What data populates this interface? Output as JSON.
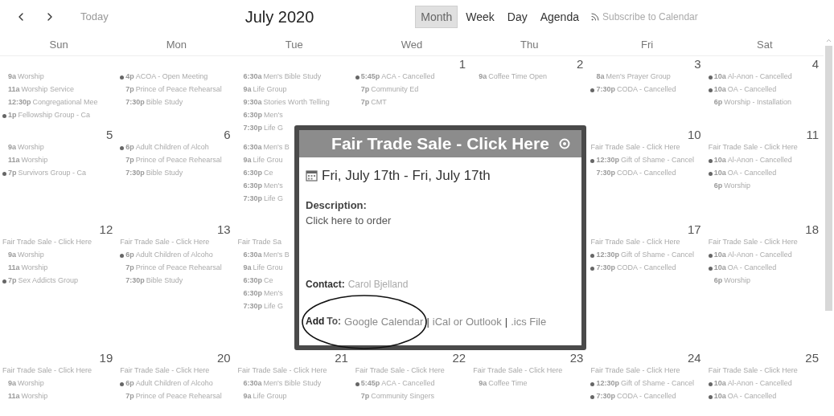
{
  "toolbar": {
    "today": "Today",
    "title": "July 2020",
    "views": [
      {
        "label": "Month",
        "selected": true
      },
      {
        "label": "Week",
        "selected": false
      },
      {
        "label": "Day",
        "selected": false
      },
      {
        "label": "Agenda",
        "selected": false
      }
    ],
    "subscribe": "Subscribe to Calendar"
  },
  "weekdays": [
    "Sun",
    "Mon",
    "Tue",
    "Wed",
    "Thu",
    "Fri",
    "Sat"
  ],
  "weeks": [
    {
      "days": [
        {
          "kind": "day",
          "events": [
            {
              "kind": "timed",
              "bullet": false,
              "time": "9a",
              "title": "Worship"
            },
            {
              "kind": "timed",
              "bullet": false,
              "time": "11a",
              "title": "Worship Service"
            },
            {
              "kind": "timed",
              "bullet": false,
              "time": "12:30p",
              "title": "Congregational Mee"
            },
            {
              "kind": "timed",
              "bullet": true,
              "time": "1p",
              "title": "Fellowship Group - Ca"
            }
          ]
        },
        {
          "kind": "day",
          "events": [
            {
              "kind": "timed",
              "bullet": true,
              "time": "4p",
              "title": "ACOA - Open Meeting"
            },
            {
              "kind": "timed",
              "bullet": false,
              "time": "7p",
              "title": "Prince of Peace Rehearsal"
            },
            {
              "kind": "timed",
              "bullet": false,
              "time": "7:30p",
              "title": "Bible Study"
            }
          ]
        },
        {
          "kind": "day",
          "events": [
            {
              "kind": "timed",
              "bullet": false,
              "time": "6:30a",
              "title": "Men's Bible Study"
            },
            {
              "kind": "timed",
              "bullet": false,
              "time": "9a",
              "title": "Life Group"
            },
            {
              "kind": "timed",
              "bullet": false,
              "time": "9:30a",
              "title": "Stories Worth Telling"
            },
            {
              "kind": "timed",
              "bullet": false,
              "time": "6:30p",
              "title": "Men's"
            },
            {
              "kind": "timed",
              "bullet": false,
              "time": "7:30p",
              "title": "Life G"
            }
          ]
        },
        {
          "kind": "day",
          "number": "1",
          "events": [
            {
              "kind": "timed",
              "bullet": true,
              "time": "5:45p",
              "title": "ACA - Cancelled"
            },
            {
              "kind": "timed",
              "bullet": false,
              "time": "7p",
              "title": "Community Ed"
            },
            {
              "kind": "timed",
              "bullet": false,
              "time": "7p",
              "title": "CMT"
            }
          ]
        },
        {
          "kind": "day",
          "number": "2",
          "events": [
            {
              "kind": "timed",
              "bullet": false,
              "time": "9a",
              "title": "Coffee Time Open"
            }
          ]
        },
        {
          "kind": "day",
          "number": "3",
          "events": [
            {
              "kind": "timed",
              "bullet": false,
              "time": "8a",
              "title": "Men's Prayer Group"
            },
            {
              "kind": "timed",
              "bullet": true,
              "time": "7:30p",
              "title": "CODA - Cancelled"
            }
          ]
        },
        {
          "kind": "day",
          "number": "4",
          "events": [
            {
              "kind": "timed",
              "bullet": true,
              "time": "10a",
              "title": "Al-Anon - Cancelled"
            },
            {
              "kind": "timed",
              "bullet": true,
              "time": "10a",
              "title": "OA - Cancelled"
            },
            {
              "kind": "timed",
              "bullet": false,
              "time": "6p",
              "title": "Worship - Installation"
            }
          ]
        }
      ]
    },
    {
      "days": [
        {
          "kind": "day",
          "number": "5",
          "events": [
            {
              "kind": "timed",
              "bullet": false,
              "time": "9a",
              "title": "Worship"
            },
            {
              "kind": "timed",
              "bullet": false,
              "time": "11a",
              "title": "Worship"
            },
            {
              "kind": "timed",
              "bullet": true,
              "time": "7p",
              "title": "Survivors Group - Ca"
            }
          ]
        },
        {
          "kind": "day",
          "number": "6",
          "events": [
            {
              "kind": "timed",
              "bullet": true,
              "time": "6p",
              "title": "Adult Children of Alcoh"
            },
            {
              "kind": "timed",
              "bullet": false,
              "time": "7p",
              "title": "Prince of Peace Rehearsal"
            },
            {
              "kind": "timed",
              "bullet": false,
              "time": "7:30p",
              "title": "Bible Study"
            }
          ]
        },
        {
          "kind": "day",
          "events": [
            {
              "kind": "timed",
              "bullet": false,
              "time": "6:30a",
              "title": "Men's B"
            },
            {
              "kind": "timed",
              "bullet": false,
              "time": "9a",
              "title": "Life Grou"
            },
            {
              "kind": "timed",
              "bullet": false,
              "time": "6:30p",
              "title": "Ce"
            },
            {
              "kind": "timed",
              "bullet": false,
              "time": "6:30p",
              "title": "Men's"
            },
            {
              "kind": "timed",
              "bullet": false,
              "time": "7:30p",
              "title": "Life G"
            }
          ]
        },
        {
          "kind": "covered"
        },
        {
          "kind": "covered"
        },
        {
          "kind": "day",
          "number": "10",
          "events": [
            {
              "kind": "allday",
              "title": "Fair Trade Sale - Click Here"
            },
            {
              "kind": "timed",
              "bullet": true,
              "time": "12:30p",
              "title": "Gift of Shame - Cancel"
            },
            {
              "kind": "timed",
              "bullet": false,
              "time": "7:30p",
              "title": "CODA - Cancelled"
            }
          ]
        },
        {
          "kind": "day",
          "number": "11",
          "events": [
            {
              "kind": "allday",
              "title": "Fair Trade Sale - Click Here"
            },
            {
              "kind": "timed",
              "bullet": true,
              "time": "10a",
              "title": "Al-Anon - Cancelled"
            },
            {
              "kind": "timed",
              "bullet": true,
              "time": "10a",
              "title": "OA - Cancelled"
            },
            {
              "kind": "timed",
              "bullet": false,
              "time": "6p",
              "title": "Worship"
            }
          ]
        }
      ]
    },
    {
      "days": [
        {
          "kind": "day",
          "number": "12",
          "events": [
            {
              "kind": "allday",
              "title": "Fair Trade Sale - Click Here"
            },
            {
              "kind": "timed",
              "bullet": false,
              "time": "9a",
              "title": "Worship"
            },
            {
              "kind": "timed",
              "bullet": false,
              "time": "11a",
              "title": "Worship"
            },
            {
              "kind": "timed",
              "bullet": true,
              "time": "7p",
              "title": "Sex Addicts Group"
            }
          ]
        },
        {
          "kind": "day",
          "number": "13",
          "events": [
            {
              "kind": "allday",
              "title": "Fair Trade Sale - Click Here"
            },
            {
              "kind": "timed",
              "bullet": true,
              "time": "6p",
              "title": "Adult Children of Alcoho"
            },
            {
              "kind": "timed",
              "bullet": false,
              "time": "7p",
              "title": "Prince of Peace Rehearsal"
            },
            {
              "kind": "timed",
              "bullet": false,
              "time": "7:30p",
              "title": "Bible Study"
            }
          ]
        },
        {
          "kind": "day",
          "events": [
            {
              "kind": "allday",
              "title": "Fair Trade Sa"
            },
            {
              "kind": "timed",
              "bullet": false,
              "time": "6:30a",
              "title": "Men's B"
            },
            {
              "kind": "timed",
              "bullet": false,
              "time": "9a",
              "title": "Life Grou"
            },
            {
              "kind": "timed",
              "bullet": false,
              "time": "6:30p",
              "title": "Ce"
            },
            {
              "kind": "timed",
              "bullet": false,
              "time": "6:30p",
              "title": "Men's"
            },
            {
              "kind": "timed",
              "bullet": false,
              "time": "7:30p",
              "title": "Life G"
            }
          ]
        },
        {
          "kind": "covered"
        },
        {
          "kind": "covered"
        },
        {
          "kind": "day",
          "number": "17",
          "events": [
            {
              "kind": "allday",
              "title": "Fair Trade Sale - Click Here"
            },
            {
              "kind": "timed",
              "bullet": true,
              "time": "12:30p",
              "title": "Gift of Shame - Cancel"
            },
            {
              "kind": "timed",
              "bullet": true,
              "time": "7:30p",
              "title": "CODA - Cancelled"
            }
          ]
        },
        {
          "kind": "day",
          "number": "18",
          "events": [
            {
              "kind": "allday",
              "title": "Fair Trade Sale - Click Here"
            },
            {
              "kind": "timed",
              "bullet": true,
              "time": "10a",
              "title": "Al-Anon - Cancelled"
            },
            {
              "kind": "timed",
              "bullet": true,
              "time": "10a",
              "title": "OA - Cancelled"
            },
            {
              "kind": "timed",
              "bullet": false,
              "time": "6p",
              "title": "Worship"
            }
          ]
        }
      ]
    },
    {
      "days": [
        {
          "kind": "day",
          "number": "19",
          "events": [
            {
              "kind": "allday",
              "title": "Fair Trade Sale - Click Here"
            },
            {
              "kind": "timed",
              "bullet": false,
              "time": "9a",
              "title": "Worship"
            },
            {
              "kind": "timed",
              "bullet": false,
              "time": "11a",
              "title": "Worship"
            }
          ]
        },
        {
          "kind": "day",
          "number": "20",
          "events": [
            {
              "kind": "allday",
              "title": "Fair Trade Sale - Click Here"
            },
            {
              "kind": "timed",
              "bullet": true,
              "time": "6p",
              "title": "Adult Children of Alcoho"
            },
            {
              "kind": "timed",
              "bullet": false,
              "time": "7p",
              "title": "Prince of Peace Rehearsal"
            }
          ]
        },
        {
          "kind": "day",
          "number": "21",
          "events": [
            {
              "kind": "allday",
              "title": "Fair Trade Sale - Click Here"
            },
            {
              "kind": "timed",
              "bullet": false,
              "time": "6:30a",
              "title": "Men's Bible Study"
            },
            {
              "kind": "timed",
              "bullet": false,
              "time": "9a",
              "title": "Life Group"
            }
          ]
        },
        {
          "kind": "day",
          "number": "22",
          "events": [
            {
              "kind": "allday",
              "title": "Fair Trade Sale - Click Here"
            },
            {
              "kind": "timed",
              "bullet": true,
              "time": "5:45p",
              "title": "ACA - Cancelled"
            },
            {
              "kind": "timed",
              "bullet": false,
              "time": "7p",
              "title": "Community Singers"
            }
          ]
        },
        {
          "kind": "day",
          "number": "23",
          "events": [
            {
              "kind": "allday",
              "title": "Fair Trade Sale - Click Here"
            },
            {
              "kind": "timed",
              "bullet": false,
              "time": "9a",
              "title": "Coffee Time"
            }
          ]
        },
        {
          "kind": "day",
          "number": "24",
          "events": [
            {
              "kind": "allday",
              "title": "Fair Trade Sale - Click Here"
            },
            {
              "kind": "timed",
              "bullet": true,
              "time": "12:30p",
              "title": "Gift of Shame - Cancel"
            },
            {
              "kind": "timed",
              "bullet": true,
              "time": "7:30p",
              "title": "CODA - Cancelled"
            }
          ]
        },
        {
          "kind": "day",
          "number": "25",
          "events": [
            {
              "kind": "allday",
              "title": "Fair Trade Sale - Click Here"
            },
            {
              "kind": "timed",
              "bullet": true,
              "time": "10a",
              "title": "Al-Anon - Cancelled"
            },
            {
              "kind": "timed",
              "bullet": true,
              "time": "10a",
              "title": "OA - Cancelled"
            }
          ]
        }
      ]
    }
  ],
  "popup": {
    "title": "Fair Trade Sale - Click Here",
    "date": "Fri, July 17th - Fri, July 17th",
    "description_label": "Description:",
    "description": "Click here to order",
    "contact_label": "Contact:",
    "contact": "Carol Bjelland",
    "add_label_bold": "Add",
    "add_label": "To:",
    "add_to": [
      {
        "kind": "link",
        "text": "Google Calendar"
      },
      {
        "kind": "separator",
        "text": "|"
      },
      {
        "kind": "link",
        "text": "iCal or Outlook"
      },
      {
        "kind": "separator",
        "text": "|"
      },
      {
        "kind": "link",
        "text": ".ics File"
      }
    ]
  }
}
